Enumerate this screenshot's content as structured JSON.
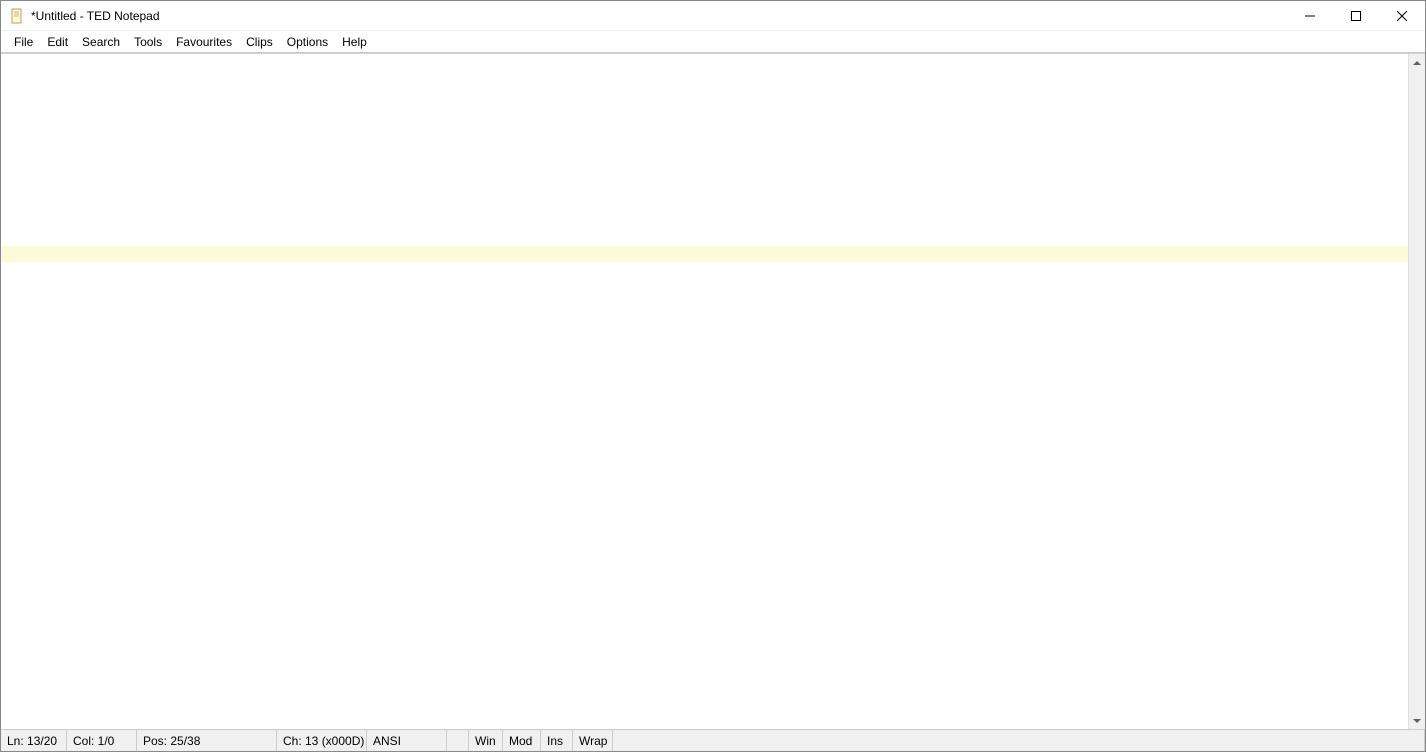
{
  "window": {
    "title": "*Untitled - TED Notepad"
  },
  "menu": {
    "items": [
      "File",
      "Edit",
      "Search",
      "Tools",
      "Favourites",
      "Clips",
      "Options",
      "Help"
    ]
  },
  "editor": {
    "content": "",
    "highlighted_line_index": 12
  },
  "status": {
    "line": "Ln: 13/20",
    "col": "Col: 1/0",
    "pos": "Pos: 25/38",
    "char": "Ch: 13 (x000D)",
    "encoding": "ANSI",
    "eol": "Win",
    "modified": "Mod",
    "insert": "Ins",
    "wrap": "Wrap"
  }
}
